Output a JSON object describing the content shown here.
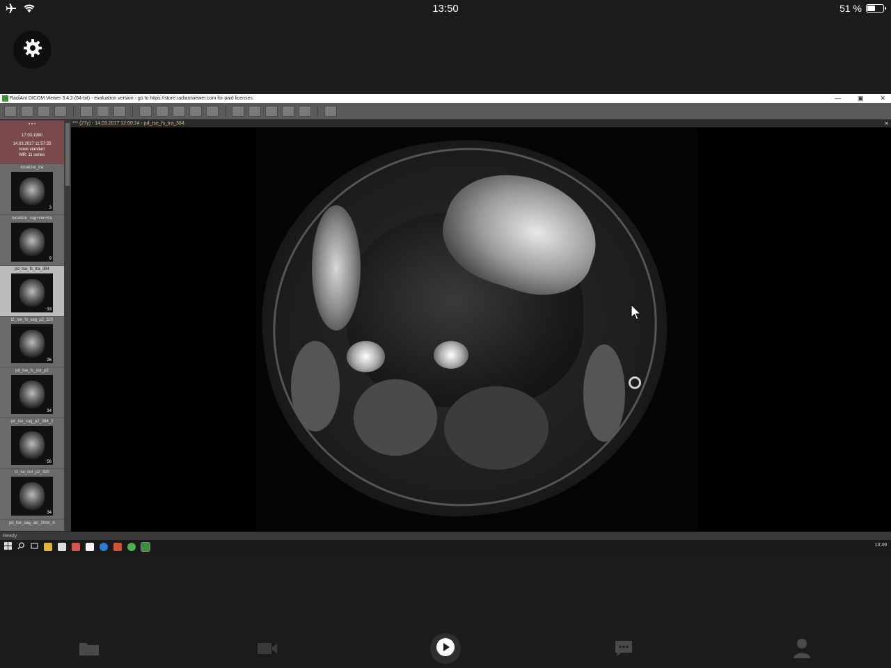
{
  "statusbar": {
    "time": "13:50",
    "battery_text": "51 %",
    "battery_level": 0.51,
    "icons": [
      "airplane-icon",
      "wifi-icon"
    ]
  },
  "app": {
    "settings_icon": "gear-icon"
  },
  "remote": {
    "window_title": "RadiAnt DICOM Viewer 3.4.2 (64-bit) - evaluation version - go to https://store.radiantviewer.com for paid licenses",
    "patient": {
      "name": "* * *",
      "dob": "17.03.1990",
      "study_date": "14.03.2017 11:57:35",
      "study_desc": "knee standart",
      "modality": "MR: 11 series"
    },
    "series": [
      {
        "label": "localizer_tra",
        "count": "3"
      },
      {
        "label": "localizer_sag+cor+tra",
        "count": "9"
      },
      {
        "label": "pd_tse_fs_tra_384",
        "count": "33"
      },
      {
        "label": "t2_tse_fs_sag_p2_320",
        "count": "26"
      },
      {
        "label": "pd_tse_fs_cor_p2",
        "count": "34"
      },
      {
        "label": "pd_tse_sag_p2_384_2",
        "count": "56"
      },
      {
        "label": "t1_se_cor_p2_320",
        "count": "34"
      },
      {
        "label": "pd_tse_sag_akl_2mm_A",
        "count": ""
      }
    ],
    "selected_series_index": 2,
    "viewport_header": "*** (27y) - 14.03.2017 12:00:24 - pd_tse_fs_tra_384",
    "status": "Ready",
    "taskbar_time": "13:49"
  },
  "bottomnav": {
    "items": [
      "folder-icon",
      "video-camera-icon",
      "play-icon",
      "chat-icon",
      "person-icon"
    ]
  }
}
